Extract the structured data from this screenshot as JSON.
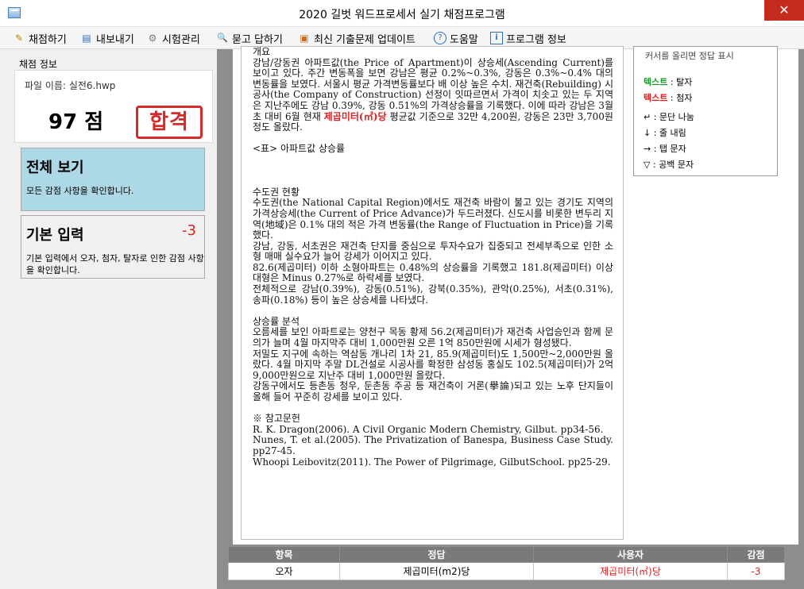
{
  "window": {
    "title": "2020 길벗 워드프로세서 실기 채점프로그램",
    "close_glyph": "✕"
  },
  "menu": [
    {
      "label": "채점하기",
      "icon": "pencil-icon",
      "glyph": "✎"
    },
    {
      "label": "내보내기",
      "icon": "export-icon",
      "glyph": "▤"
    },
    {
      "label": "시험관리",
      "icon": "gear-icon",
      "glyph": "⚙"
    },
    {
      "label": "묻고 답하기",
      "icon": "search-icon",
      "glyph": "🔍"
    },
    {
      "label": "최신 기출문제 업데이트",
      "icon": "gift-icon",
      "glyph": "▣"
    },
    {
      "label": "도움말",
      "icon": "help-icon",
      "glyph": "?"
    },
    {
      "label": "프로그램 정보",
      "icon": "info-icon",
      "glyph": "i"
    }
  ],
  "score": {
    "header": "채점 정보",
    "file_name": "파일 이름: 실전6.hwp",
    "score_text": "97 점",
    "stamp": "합격"
  },
  "categories": {
    "all": {
      "title": "전체 보기",
      "desc": "모든 감점 사항을 확인합니다."
    },
    "basic": {
      "title": "기본 입력",
      "deduct": "-3",
      "desc": "기본 입력에서 오자, 첨자, 탈자로 인한 감점 사항을 확인합니다."
    }
  },
  "document": {
    "lines": [
      "개요",
      "강남/강동권 아파트값(the Price of Apartment)이 상승세(Ascending Current)를 보이고 있다. 주간 변동폭을 보면 강남은 평균 0.2%~0.3%, 강동은 0.3%~0.4% 대의 변동률을 보였다. 서울시 평균 가격변동률보다 배 이상 높은 수치. 재건축(Rebuilding) 시공사(the Company of Construction) 선정이 잇따르면서 가격이 치솟고 있는 두 지역은 지난주에도 강남 0.39%, 강동 0.51%의 가격상승률을 기록했다. 이에 따라 강남은 3월초 대비 6월 현재 ",
      "평균값 기준으로 32만 4,200원, 강동은 23만 3,700원 정도 올랐다.",
      "",
      "<표> 아파트값 상승률",
      "",
      "",
      "수도권 현황",
      "수도권(the National Capital Region)에서도 재건축 바람이 불고 있는 경기도 지역의 가격상승세(the Current of Price Advance)가 두드러졌다. 신도시를 비롯한 변두리 지역(地域)은 0.1% 대의 적은 가격 변동률(the Range of Fluctuation in Price)을 기록했다.",
      "강남, 강동, 서초권은 재건축 단지를 중심으로 투자수요가 집중되고 전세부족으로 인한 소형 매매 실수요가 늘어 강세가 이어지고 있다.",
      "82.6(제곱미터) 이하 소형아파트는 0.48%의 상승률을 기록했고 181.8(제곱미터) 이상 대형은 Minus 0.27%로 하락세를 보였다.",
      "전체적으로 강남(0.39%), 강동(0.51%), 강북(0.35%), 관악(0.25%), 서초(0.31%), 송파(0.18%) 등이 높은 상승세를 나타냈다.",
      "",
      "상승률 분석",
      "오름세를 보인 아파트로는 양천구 목동 황제 56.2(제곱미터)가 재건축 사업승인과 함께 문의가 늘며 4월 마지막주 대비 1,000만원 오른 1억 850만원에 시세가 형성됐다.",
      "저밀도 지구에 속하는 역삼동 개나리 1차 21, 85.9(제곱미터)도 1,500만~2,000만원 올랐다. 4월 마지막 주말 DL건설로 시공사를 확정한 삼성동 홍실도 102.5(제곱미터)가 2억 9,000만원으로 지난주 대비 1,000만원 올랐다.",
      "강동구에서도 등촌동 청우, 둔촌동 주공 등 재건축이 거론(擧論)되고 있는 노후 단지들이 올해 들어 꾸준히 강세를 보이고 있다.",
      "",
      "※ 참고문헌",
      "R. K. Dragon(2006). A Civil Organic Modern Chemistry, Gilbut. pp34-56.",
      "Nunes, T. et al.(2005). The Privatization of Banespa, Business Case Study. pp27-45.",
      "Whoopi Leibovitz(2011). The Power of Pilgrimage, GilbutSchool. pp25-29."
    ],
    "highlight": "제곱미터(㎡)당"
  },
  "legend": {
    "hint": "커서를 올리면 정답 표시",
    "items": [
      {
        "label": "텍스트",
        "suffix": " : 탈자",
        "color": "#1a9b2b",
        "bold": true
      },
      {
        "label": "텍스트",
        "suffix": " : 첨자",
        "color": "#e02020",
        "bold": true
      },
      {
        "label": "↵ : 문단 나눔",
        "suffix": "",
        "color": "#000000",
        "bold": false
      },
      {
        "label": "↓ : 줄 내림",
        "suffix": "",
        "color": "#000000",
        "bold": false
      },
      {
        "label": "→ : 탭 문자",
        "suffix": "",
        "color": "#000000",
        "bold": false
      },
      {
        "label": "▽ : 공백 문자",
        "suffix": "",
        "color": "#000000",
        "bold": false
      }
    ]
  },
  "result_table": {
    "headers": [
      "항목",
      "정답",
      "사용자",
      "감점"
    ],
    "rows": [
      [
        "오자",
        "제곱미터(m2)당",
        "제곱미터(㎡)당",
        "-3"
      ]
    ]
  },
  "colors": {
    "accent_red": "#e02020",
    "selected_card": "#add8e6",
    "splitter_gray": "#8e8e8e"
  }
}
